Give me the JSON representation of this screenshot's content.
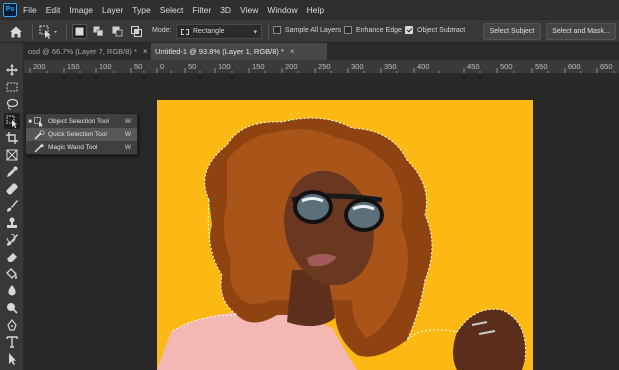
{
  "app": {
    "logo": "Ps"
  },
  "menu": [
    "File",
    "Edit",
    "Image",
    "Layer",
    "Type",
    "Select",
    "Filter",
    "3D",
    "View",
    "Window",
    "Help"
  ],
  "options": {
    "mode_label": "Mode:",
    "mode_value": "Rectangle",
    "sample_all_layers": {
      "label": "Sample All Layers",
      "checked": false
    },
    "enhance_edge": {
      "label": "Enhance Edge",
      "checked": false
    },
    "object_subtract": {
      "label": "Object Subtract",
      "checked": true
    },
    "select_subject": "Select Subject",
    "select_and_mask": "Select and Mask..."
  },
  "tabs": [
    {
      "label": "osd @ 66.7% (Layer 7, RGB/8) *",
      "active": false
    },
    {
      "label": "Untitled-1 @ 93.8% (Layer 1, RGB/8) *",
      "active": true
    }
  ],
  "ruler": [
    "200",
    "150",
    "100",
    "50",
    "0",
    "50",
    "100",
    "150",
    "200",
    "250",
    "300",
    "350",
    "400",
    "450",
    "500",
    "550",
    "600",
    "650"
  ],
  "flyout": [
    {
      "label": "Object Selection Tool",
      "key": "W",
      "active": true,
      "icon": "object-selection-icon"
    },
    {
      "label": "Quick Selection Tool",
      "key": "W",
      "active": false,
      "icon": "quick-selection-icon"
    },
    {
      "label": "Magic Wand Tool",
      "key": "W",
      "active": false,
      "icon": "magic-wand-icon"
    }
  ],
  "tools": [
    "move-icon",
    "marquee-icon",
    "lasso-icon",
    "object-selection-icon",
    "crop-icon",
    "frame-icon",
    "eyedropper-icon",
    "healing-icon",
    "brush-icon",
    "stamp-icon",
    "history-brush-icon",
    "eraser-icon",
    "paint-bucket-icon",
    "blur-icon",
    "dodge-icon",
    "pen-icon",
    "type-icon",
    "path-selection-icon"
  ],
  "colors": {
    "canvas_background": "#fdb913",
    "hair": "#9a4a12",
    "skin": "#6e3a22",
    "sweater": "#f0b7b3",
    "app_background": "#282828"
  }
}
